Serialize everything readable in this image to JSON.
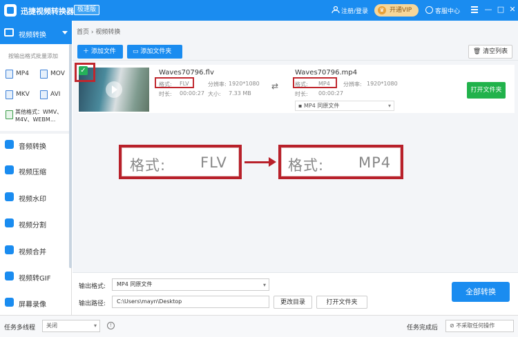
{
  "app": {
    "title": "迅捷视频转换器",
    "badge": "极速版"
  },
  "titlebar": {
    "login": "注册/登录",
    "vip": "开通VIP",
    "service": "客服中心",
    "minimize": "—",
    "maximize": "□",
    "close": "✕"
  },
  "sidebar": {
    "active": "视频转换",
    "hint": "按输出格式批量添加",
    "formats": [
      "MP4",
      "MOV",
      "MKV",
      "AVI"
    ],
    "other_formats": "其他格式：WMV、M4V、WEBM...",
    "items": [
      "音频转换",
      "视频压缩",
      "视频水印",
      "视频分割",
      "视频合并",
      "视频转GIF",
      "屏幕录像"
    ]
  },
  "main": {
    "breadcrumb": "首页 › 视频转换",
    "add_file": "＋ 添加文件",
    "add_folder": "添加文件夹",
    "clear_list": "清空列表"
  },
  "file": {
    "src_name": "Waves70796.flv",
    "src_format_label": "格式:",
    "src_format": "FLV",
    "src_res_label": "分辨率:",
    "src_res": "1920*1080",
    "src_dur_label": "时长:",
    "src_dur": "00:00:27",
    "src_size_label": "大小:",
    "src_size": "7.33 MB",
    "dst_name": "Waves70796.mp4",
    "dst_format_label": "格式:",
    "dst_format": "MP4",
    "dst_res_label": "分辨率:",
    "dst_res": "1920*1080",
    "dst_dur_label": "时长:",
    "dst_dur": "00:00:27",
    "dst_select": "MP4  同原文件",
    "open_folder": "打开文件夹"
  },
  "zoom": {
    "label1": "格式:",
    "value1": "FLV",
    "label2": "格式:",
    "value2": "MP4"
  },
  "bottom": {
    "output_format_label": "输出格式:",
    "output_format": "MP4  同原文件",
    "output_path_label": "输出路径:",
    "output_path": "C:\\Users\\mayn\\Desktop",
    "change_dir": "更改目录",
    "open_folder": "打开文件夹",
    "convert_all": "全部转换"
  },
  "status": {
    "multithread_label": "任务多线程",
    "multithread_value": "关闭",
    "after_label": "任务完成后",
    "after_value": "不采取任何操作"
  },
  "colors": {
    "primary": "#1a8cf0",
    "green": "#21b24b",
    "highlight_red": "#c0262d"
  }
}
